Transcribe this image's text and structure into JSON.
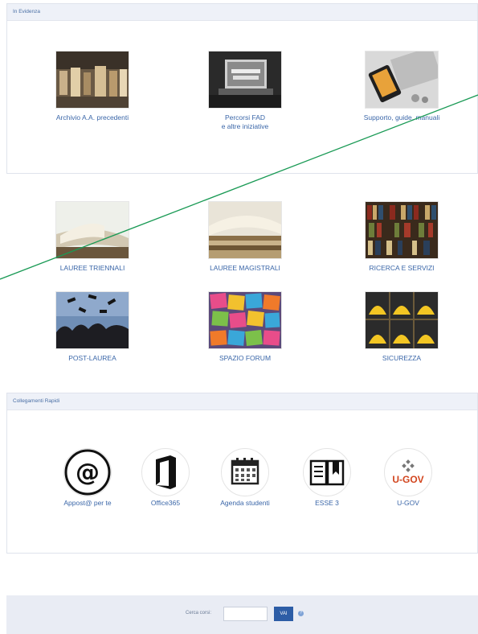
{
  "evidence": {
    "title": "In Evidenza",
    "items": [
      {
        "label": "Archivio A.A. precedenti",
        "icon": "archive-photo"
      },
      {
        "label": "Percorsi FAD\ne altre iniziative",
        "icon": "learning-laptop-photo"
      },
      {
        "label": "Supporto, guide, manuali",
        "icon": "phone-keyboard-photo"
      }
    ]
  },
  "categories": {
    "items": [
      {
        "label": "LAUREE TRIENNALI",
        "icon": "open-book-photo"
      },
      {
        "label": "LAUREE MAGISTRALI",
        "icon": "book-stack-photo"
      },
      {
        "label": "RICERCA E SERVIZI",
        "icon": "bookshelf-photo"
      },
      {
        "label": "POST-LAUREA",
        "icon": "graduation-caps-photo"
      },
      {
        "label": "SPAZIO FORUM",
        "icon": "sticky-notes-photo"
      },
      {
        "label": "SICUREZZA",
        "icon": "hard-hats-photo"
      }
    ]
  },
  "quicklinks": {
    "title": "Collegamenti Rapidi",
    "items": [
      {
        "label": "Appost@ per te",
        "icon": "at-sign-icon"
      },
      {
        "label": "Office365",
        "icon": "office-icon"
      },
      {
        "label": "Agenda studenti",
        "icon": "calendar-icon"
      },
      {
        "label": "ESSE 3",
        "icon": "book-icon"
      },
      {
        "label": "U-GOV",
        "icon": "ugov-logo-icon",
        "logo_text": "U-GOV"
      }
    ]
  },
  "search": {
    "label": "Cerca corsi:",
    "value": "",
    "button": "VAI",
    "help": "?"
  },
  "colors": {
    "link": "#3a66a8",
    "header_bg": "#eef1f8",
    "button": "#2d5da6",
    "annotation_line": "#1a9a55"
  }
}
